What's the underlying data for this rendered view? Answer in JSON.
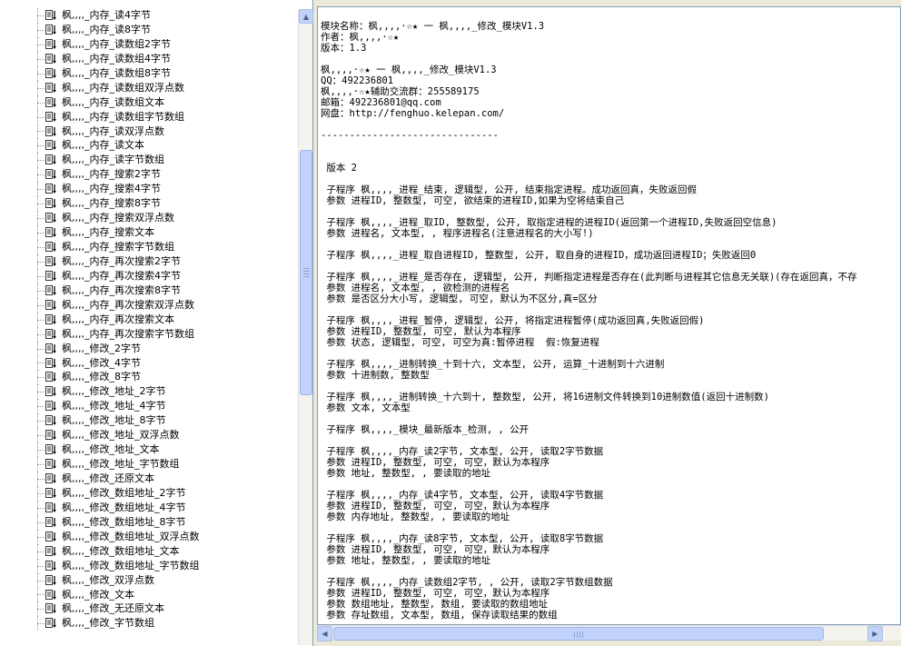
{
  "tree": {
    "items": [
      "枫,,,,_内存_读4字节",
      "枫,,,,_内存_读8字节",
      "枫,,,,_内存_读数组2字节",
      "枫,,,,_内存_读数组4字节",
      "枫,,,,_内存_读数组8字节",
      "枫,,,,_内存_读数组双浮点数",
      "枫,,,,_内存_读数组文本",
      "枫,,,,_内存_读数组字节数组",
      "枫,,,,_内存_读双浮点数",
      "枫,,,,_内存_读文本",
      "枫,,,,_内存_读字节数组",
      "枫,,,,_内存_搜索2字节",
      "枫,,,,_内存_搜索4字节",
      "枫,,,,_内存_搜索8字节",
      "枫,,,,_内存_搜索双浮点数",
      "枫,,,,_内存_搜索文本",
      "枫,,,,_内存_搜索字节数组",
      "枫,,,,_内存_再次搜索2字节",
      "枫,,,,_内存_再次搜索4字节",
      "枫,,,,_内存_再次搜索8字节",
      "枫,,,,_内存_再次搜索双浮点数",
      "枫,,,,_内存_再次搜索文本",
      "枫,,,,_内存_再次搜索字节数组",
      "枫,,,,_修改_2字节",
      "枫,,,,_修改_4字节",
      "枫,,,,_修改_8字节",
      "枫,,,,_修改_地址_2字节",
      "枫,,,,_修改_地址_4字节",
      "枫,,,,_修改_地址_8字节",
      "枫,,,,_修改_地址_双浮点数",
      "枫,,,,_修改_地址_文本",
      "枫,,,,_修改_地址_字节数组",
      "枫,,,,_修改_还原文本",
      "枫,,,,_修改_数组地址_2字节",
      "枫,,,,_修改_数组地址_4字节",
      "枫,,,,_修改_数组地址_8字节",
      "枫,,,,_修改_数组地址_双浮点数",
      "枫,,,,_修改_数组地址_文本",
      "枫,,,,_修改_数组地址_字节数组",
      "枫,,,,_修改_双浮点数",
      "枫,,,,_修改_文本",
      "枫,,,,_修改_无还原文本",
      "枫,,,,_修改_字节数组"
    ]
  },
  "doc": {
    "lines": [
      "模块名称：枫,,,,·☆★ 一 枫,,,,_修改_模块V1.3",
      "作者：枫,,,,·☆★",
      "版本：1.3",
      "",
      "枫,,,,·☆★ 一 枫,,,,_修改_模块V1.3",
      "QQ：492236801",
      "枫,,,,·☆★辅助交流群：255589175",
      "邮箱：492236801@qq.com",
      "网盘：http://fenghuo.kelepan.com/",
      "",
      "-------------------------------",
      "",
      "",
      " 版本 2",
      "",
      " 子程序 枫,,,,_进程_结束, 逻辑型, 公开, 结束指定进程。成功返回真，失败返回假",
      " 参数 进程ID, 整数型, 可空, 欲结束的进程ID,如果为空将结束自己",
      "",
      " 子程序 枫,,,,_进程_取ID, 整数型, 公开, 取指定进程的进程ID(返回第一个进程ID,失败返回空信息)",
      " 参数 进程名, 文本型, , 程序进程名(注意进程名的大小写!)",
      "",
      " 子程序 枫,,,,_进程_取自进程ID, 整数型, 公开, 取自身的进程ID，成功返回进程ID；失败返回0",
      "",
      " 子程序 枫,,,,_进程_是否存在, 逻辑型, 公开, 判断指定进程是否存在(此判断与进程其它信息无关联)(存在返回真，不存",
      " 参数 进程名, 文本型, , 欲检测的进程名",
      " 参数 是否区分大小写, 逻辑型, 可空, 默认为不区分,真=区分",
      "",
      " 子程序 枫,,,,_进程_暂停, 逻辑型, 公开, 将指定进程暂停(成功返回真,失败返回假)",
      " 参数 进程ID, 整数型, 可空, 默认为本程序",
      " 参数 状态, 逻辑型, 可空, 可空为真:暂停进程  假:恢复进程",
      "",
      " 子程序 枫,,,,_进制转换_十到十六, 文本型, 公开, 运算_十进制到十六进制",
      " 参数 十进制数, 整数型",
      "",
      " 子程序 枫,,,,_进制转换_十六到十, 整数型, 公开, 将16进制文件转换到10进制数值(返回十进制数)",
      " 参数 文本, 文本型",
      "",
      " 子程序 枫,,,,_模块_最新版本_检测, , 公开",
      "",
      " 子程序 枫,,,,_内存_读2字节, 文本型, 公开, 读取2字节数据",
      " 参数 进程ID, 整数型, 可空, 可空，默认为本程序",
      " 参数 地址, 整数型, , 要读取的地址",
      "",
      " 子程序 枫,,,,_内存_读4字节, 文本型, 公开, 读取4字节数据",
      " 参数 进程ID, 整数型, 可空, 可空，默认为本程序",
      " 参数 内存地址, 整数型, , 要读取的地址",
      "",
      " 子程序 枫,,,,_内存_读8字节, 文本型, 公开, 读取8字节数据",
      " 参数 进程ID, 整数型, 可空, 可空，默认为本程序",
      " 参数 地址, 整数型, , 要读取的地址",
      "",
      " 子程序 枫,,,,_内存_读数组2字节, , 公开, 读取2字节数组数据",
      " 参数 进程ID, 整数型, 可空, 可空，默认为本程序",
      " 参数 数组地址, 整数型, 数组, 要读取的数组地址",
      " 参数 存址数组, 文本型, 数组, 保存读取结果的数组"
    ]
  },
  "scrollbars": {
    "left_vertical": {
      "position": 0.62,
      "visible_fraction": 0.5
    },
    "right_horizontal": {
      "position": 0.0,
      "visible_fraction": 0.88
    }
  },
  "colors": {
    "window_bg": "#ece9d8",
    "pane_border": "#7f9db9",
    "scrollbar_thumb": "#c1d3fb"
  }
}
